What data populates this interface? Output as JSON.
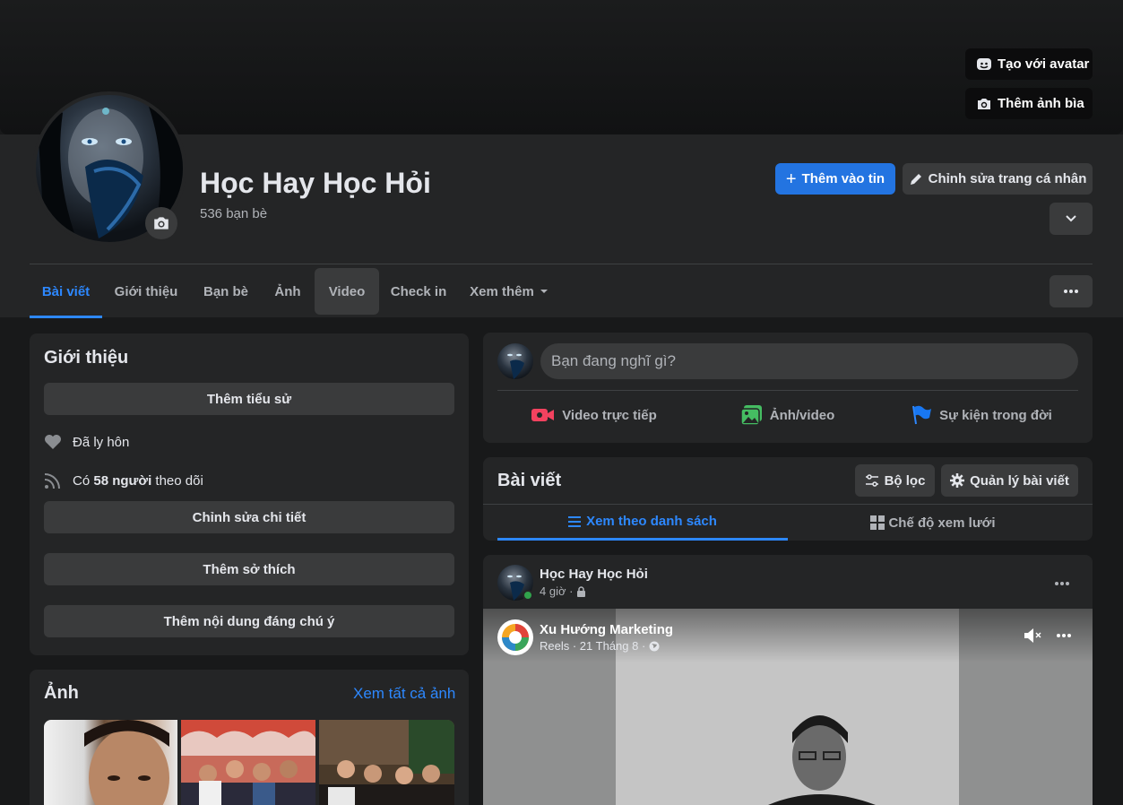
{
  "cover": {
    "create_avatar_label": "Tạo với avatar",
    "add_cover_label": "Thêm ảnh bìa"
  },
  "profile": {
    "name": "Học Hay Học Hỏi",
    "friends_count": "536 bạn bè",
    "add_story_label": "Thêm vào tin",
    "edit_profile_label": "Chỉnh sửa trang cá nhân"
  },
  "tabs": [
    {
      "label": "Bài viết"
    },
    {
      "label": "Giới thiệu"
    },
    {
      "label": "Bạn bè"
    },
    {
      "label": "Ảnh"
    },
    {
      "label": "Video"
    },
    {
      "label": "Check in"
    },
    {
      "label": "Xem thêm"
    }
  ],
  "intro": {
    "title": "Giới thiệu",
    "add_bio": "Thêm tiểu sử",
    "relationship": "Đã ly hôn",
    "followers_prefix": "Có",
    "followers_count": "58 người",
    "followers_suffix": "theo dõi",
    "edit_details": "Chỉnh sửa chi tiết",
    "add_hobbies": "Thêm sở thích",
    "add_featured": "Thêm nội dung đáng chú ý"
  },
  "photos": {
    "title": "Ảnh",
    "see_all": "Xem tất cả ảnh"
  },
  "composer": {
    "placeholder": "Bạn đang nghĩ gì?",
    "live_video": "Video trực tiếp",
    "photo_video": "Ảnh/video",
    "life_event": "Sự kiện trong đời"
  },
  "posts_header": {
    "title": "Bài viết",
    "filter": "Bộ lọc",
    "manage": "Quản lý bài viết",
    "list_view": "Xem theo danh sách",
    "grid_view": "Chế độ xem lưới"
  },
  "post": {
    "author": "Học Hay Học Hỏi",
    "time": "4 giờ ·",
    "shared_author": "Xu Hướng Marketing",
    "shared_meta": "Reels · 21 Tháng 8 ·"
  },
  "colors": {
    "accent": "#2d88ff",
    "primary_button": "#2374e1",
    "card": "#242526",
    "background": "#18191a"
  }
}
